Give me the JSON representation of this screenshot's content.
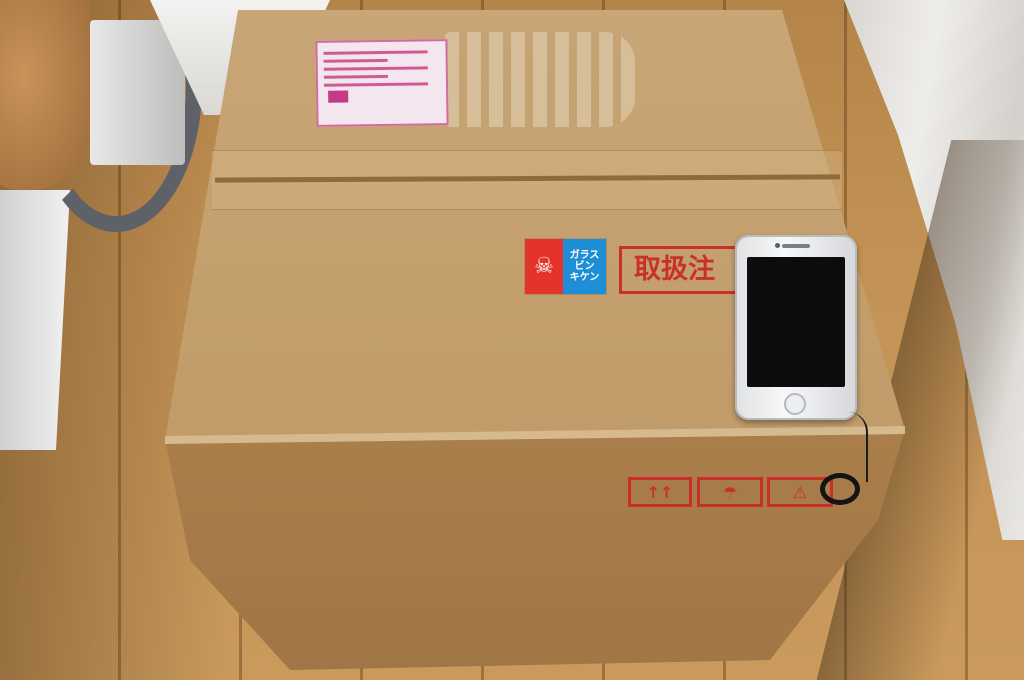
{
  "scene": {
    "description_free": true,
    "labels": {
      "handling_text": "取扱注",
      "glass_sticker_text": "ガラス\nビン\nキケン"
    },
    "icons": {
      "glass_sticker_icon": "broken-glass-icon",
      "up_arrows_icon": "this-side-up-icon",
      "umbrella_icon": "keep-dry-umbrella-icon",
      "fragile_icon": "fragile-glass-icon"
    },
    "colors": {
      "cardboard": "#c29d6b",
      "warning_red": "#c9302c",
      "sticker_blue": "#1e8fd6",
      "label_pink": "#d36aa0",
      "phone_silver": "#e6e8ea",
      "floor_wood": "#c39255"
    }
  }
}
